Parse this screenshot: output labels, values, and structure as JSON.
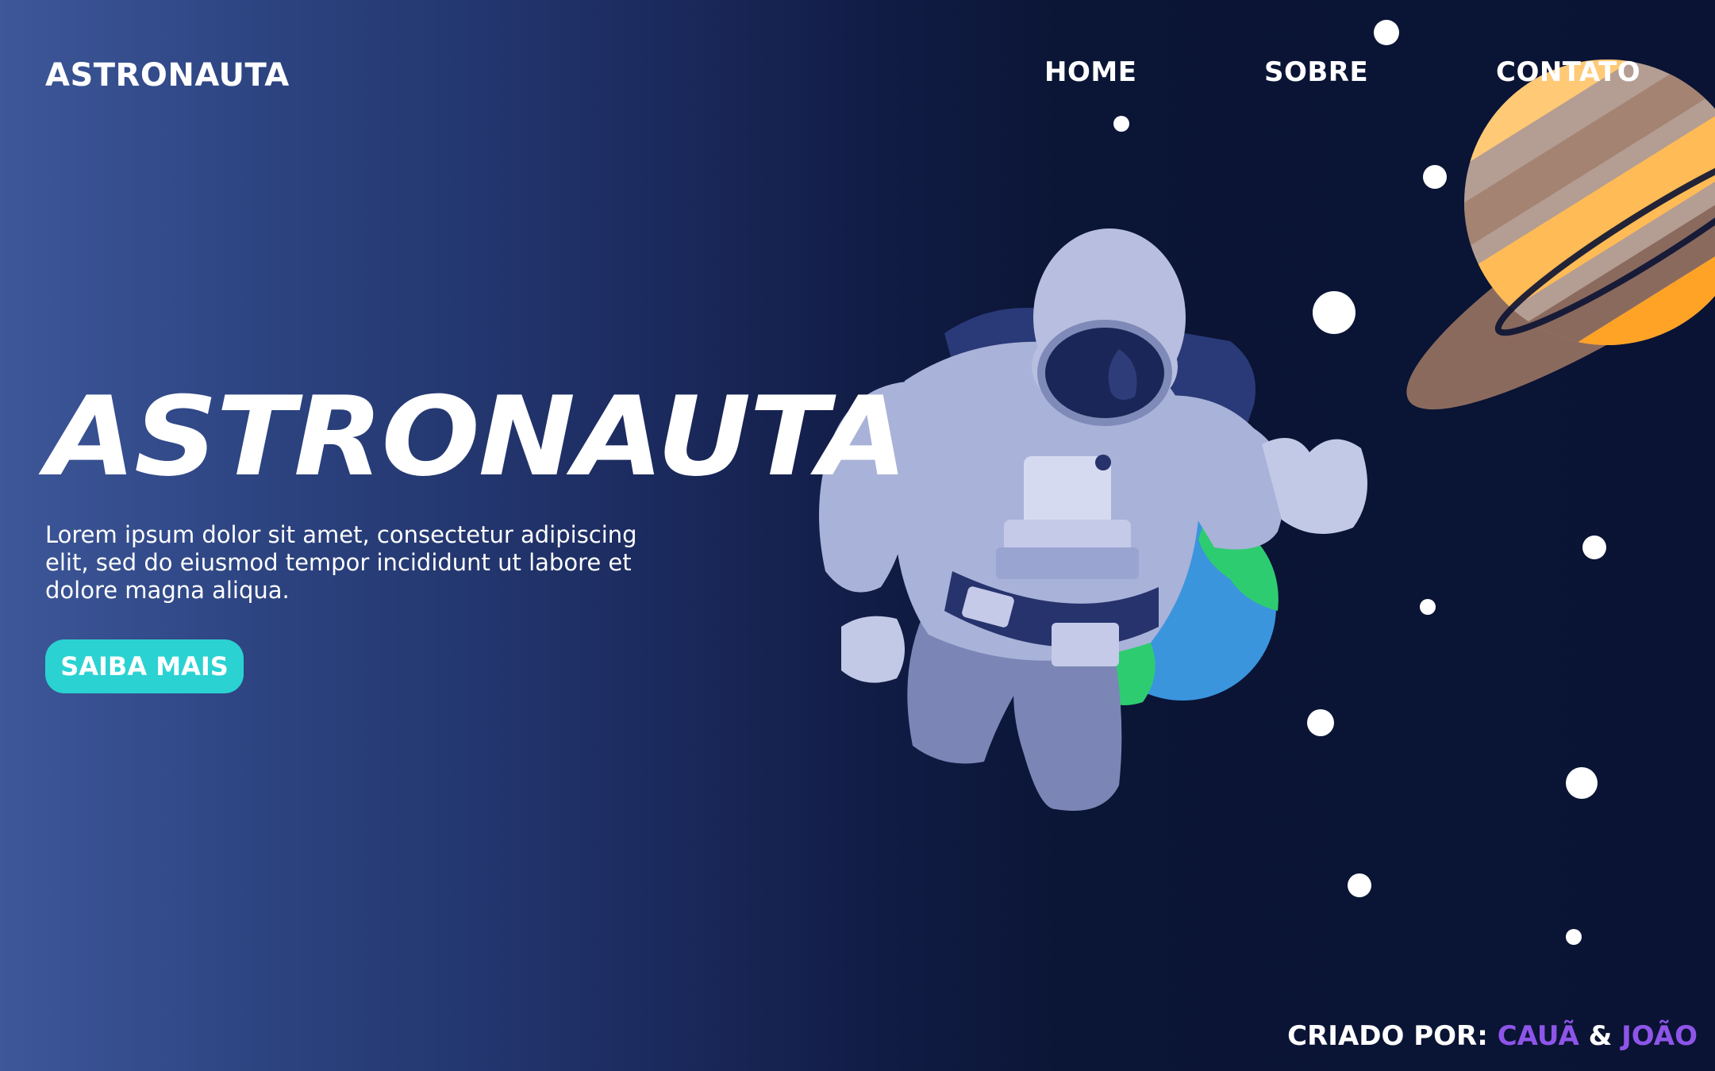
{
  "header": {
    "logo": "ASTRONAUTA",
    "nav": {
      "home": "HOME",
      "sobre": "SOBRE",
      "contato": "CONTATO"
    }
  },
  "hero": {
    "title": "ASTRONAUTA",
    "description": "Lorem ipsum dolor sit amet, consectetur adipiscing elit, sed do eiusmod tempor incididunt ut labore et dolore magna aliqua.",
    "cta_label": "SAIBA MAIS"
  },
  "footer": {
    "credit_prefix": "CRIADO POR:",
    "author_1": "CAUÃ",
    "separator": "&",
    "author_2": "JOÃO"
  },
  "colors": {
    "background_left": "#3d5799",
    "background_right": "#0a1333",
    "cta": "#2bd2d2",
    "author_highlight": "#8e55e9",
    "text": "#ffffff"
  },
  "icons": [
    "astronaut-illustration",
    "planet-earth-icon",
    "planet-saturn-icon",
    "star-dot-icon"
  ]
}
